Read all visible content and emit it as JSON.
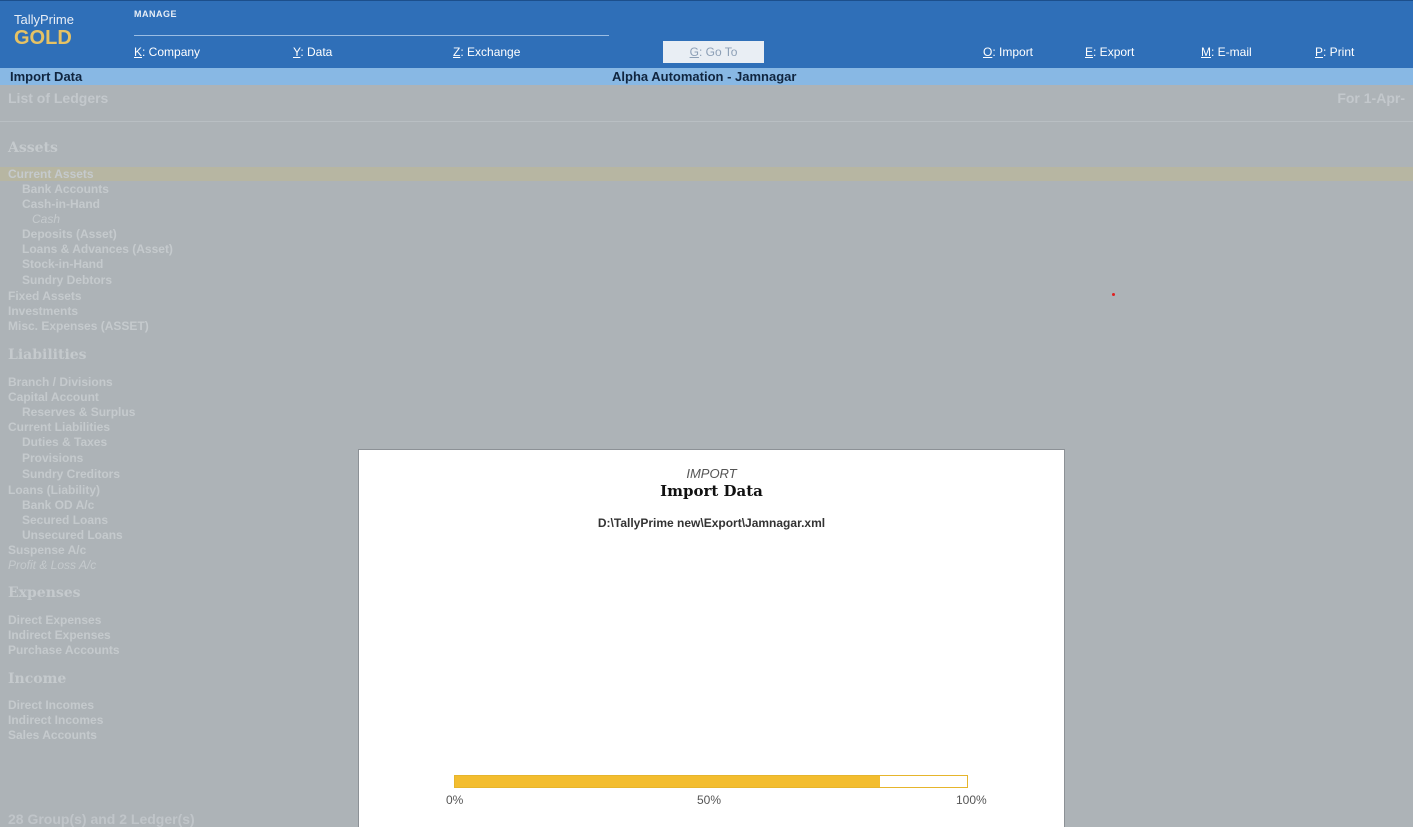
{
  "header": {
    "app_name": "TallyPrime",
    "edition": "GOLD",
    "mode_label": "MANAGE",
    "menu": [
      {
        "key": "K",
        "label": ": Company"
      },
      {
        "key": "Y",
        "label": ": Data"
      },
      {
        "key": "Z",
        "label": ": Exchange"
      },
      {
        "key": "G",
        "label": ": Go To"
      },
      {
        "key": "O",
        "label": ": Import"
      },
      {
        "key": "E",
        "label": ": Export"
      },
      {
        "key": "M",
        "label": ": E-mail"
      },
      {
        "key": "P",
        "label": ": Print"
      }
    ]
  },
  "titlebar": {
    "screen": "Import Data",
    "company": "Alpha Automation - Jamnagar"
  },
  "report": {
    "title": "List of Ledgers",
    "period": "For 1-Apr-",
    "lines": [
      "Assets",
      "Current Assets",
      "Bank Accounts",
      "Cash-in-Hand",
      "Cash",
      "Deposits (Asset)",
      "Loans & Advances (Asset)",
      "Stock-in-Hand",
      "Sundry Debtors",
      "Fixed Assets",
      "Investments",
      "Misc. Expenses (ASSET)",
      "Liabilities",
      "Branch / Divisions",
      "Capital Account",
      "Reserves & Surplus",
      "Current Liabilities",
      "Duties & Taxes",
      "Provisions",
      "Sundry Creditors",
      "Loans (Liability)",
      "Bank OD A/c",
      "Secured Loans",
      "Unsecured Loans",
      "Suspense A/c",
      "Profit & Loss A/c",
      "Expenses",
      "Direct Expenses",
      "Indirect Expenses",
      "Purchase Accounts",
      "Income",
      "Direct Incomes",
      "Indirect Incomes",
      "Sales Accounts"
    ],
    "footer": "28 Group(s) and 2 Ledger(s)"
  },
  "modal": {
    "kicker": "IMPORT",
    "title": "Import Data",
    "file_path": "D:\\TallyPrime new\\Export\\Jamnagar.xml",
    "progress": 0.83,
    "ticks": [
      "0%",
      "50%",
      "100%"
    ],
    "accent_color": "#f3bd2f"
  }
}
